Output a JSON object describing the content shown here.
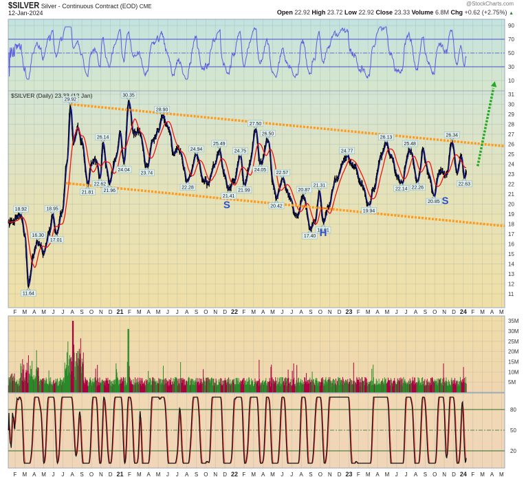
{
  "header": {
    "symbol": "$SILVER",
    "description": "Silver - Continuous Contract (EOD)",
    "exchange": "CME",
    "date": "12-Jan-2024",
    "brand": "@StockCharts.com",
    "open_label": "Open",
    "open": "22.92",
    "high_label": "High",
    "high": "23.72",
    "low_label": "Low",
    "low": "22.92",
    "close_label": "Close",
    "close": "23.33",
    "volume_label": "Volume",
    "volume": "6.8M",
    "chg_label": "Chg",
    "chg": "+0.62 (+2.75%)",
    "chg_icon": "triangle-up-icon"
  },
  "chart_data": {
    "type": "line",
    "title": "$SILVER Silver - Continuous Contract (EOD) CME",
    "price_label": "$SILVER (Daily) 23.33 (12 Jan)",
    "x_unit": "months since Feb 2020",
    "x_labels": [
      "F",
      "M",
      "A",
      "M",
      "J",
      "J",
      "A",
      "S",
      "O",
      "N",
      "D",
      "21",
      "F",
      "M",
      "A",
      "M",
      "J",
      "J",
      "A",
      "S",
      "O",
      "N",
      "D",
      "22",
      "F",
      "M",
      "A",
      "M",
      "J",
      "J",
      "A",
      "S",
      "O",
      "N",
      "D",
      "23",
      "F",
      "M",
      "A",
      "M",
      "J",
      "J",
      "A",
      "S",
      "O",
      "N",
      "D",
      "24",
      "F",
      "M",
      "A",
      "M"
    ],
    "year_labels": [
      "21",
      "22",
      "23",
      "24"
    ],
    "price_ticks": [
      11,
      12,
      13,
      14,
      15,
      16,
      17,
      18,
      19,
      20,
      21,
      22,
      23,
      24,
      25,
      26,
      27,
      28,
      29,
      30,
      31
    ],
    "rsi_ticks": [
      90,
      70,
      50,
      30,
      10
    ],
    "volume_ticks": [
      "35M",
      "30M",
      "25M",
      "20M",
      "15M",
      "10M",
      "5M"
    ],
    "stoch_ticks": [
      80,
      50,
      20
    ],
    "price_keypoints": [
      [
        -0.7,
        18.0
      ],
      [
        0.6,
        18.92
      ],
      [
        1.0,
        17
      ],
      [
        1.4,
        11.64
      ],
      [
        1.9,
        15
      ],
      [
        2.4,
        16.3
      ],
      [
        3.0,
        15.2
      ],
      [
        3.6,
        17
      ],
      [
        3.9,
        18.95
      ],
      [
        4.3,
        17.01
      ],
      [
        4.9,
        19
      ],
      [
        5.4,
        24
      ],
      [
        5.8,
        29.92
      ],
      [
        6.1,
        26
      ],
      [
        6.6,
        27.5
      ],
      [
        7.0,
        26
      ],
      [
        7.6,
        21.81
      ],
      [
        8.0,
        24
      ],
      [
        8.4,
        24.5
      ],
      [
        8.9,
        22.62
      ],
      [
        9.2,
        26.14
      ],
      [
        9.6,
        23.5
      ],
      [
        9.9,
        21.96
      ],
      [
        10.5,
        24.5
      ],
      [
        11.0,
        27
      ],
      [
        11.4,
        24.04
      ],
      [
        11.9,
        30.35
      ],
      [
        12.4,
        27
      ],
      [
        13.0,
        27.5
      ],
      [
        13.8,
        23.74
      ],
      [
        14.5,
        26.5
      ],
      [
        15.0,
        27.5
      ],
      [
        15.4,
        28.9
      ],
      [
        16.1,
        27.5
      ],
      [
        16.6,
        25
      ],
      [
        17.2,
        25.5
      ],
      [
        18.1,
        22.28
      ],
      [
        19.0,
        24.94
      ],
      [
        19.7,
        22.5
      ],
      [
        20.2,
        22
      ],
      [
        20.9,
        24
      ],
      [
        21.4,
        25.49
      ],
      [
        21.9,
        23
      ],
      [
        22.4,
        21.41
      ],
      [
        23.0,
        22.5
      ],
      [
        23.6,
        24.75
      ],
      [
        24.0,
        21.99
      ],
      [
        24.6,
        24
      ],
      [
        25.2,
        27.5
      ],
      [
        25.7,
        24.05
      ],
      [
        26.5,
        26.5
      ],
      [
        27.0,
        22.5
      ],
      [
        27.4,
        20.42
      ],
      [
        28.0,
        22.57
      ],
      [
        28.7,
        21
      ],
      [
        29.4,
        18.5
      ],
      [
        30.3,
        20.87
      ],
      [
        30.9,
        17.4
      ],
      [
        31.5,
        18.5
      ],
      [
        31.9,
        21.31
      ],
      [
        32.3,
        18.01
      ],
      [
        32.9,
        20
      ],
      [
        33.6,
        22.5
      ],
      [
        34.3,
        24
      ],
      [
        34.8,
        24.77
      ],
      [
        35.5,
        24
      ],
      [
        36.3,
        22
      ],
      [
        37.1,
        19.94
      ],
      [
        37.7,
        22
      ],
      [
        38.3,
        24.5
      ],
      [
        38.9,
        26.13
      ],
      [
        39.4,
        25
      ],
      [
        40.0,
        23
      ],
      [
        40.5,
        22.14
      ],
      [
        41.4,
        25.48
      ],
      [
        42.2,
        22.26
      ],
      [
        42.8,
        25.3
      ],
      [
        43.3,
        23
      ],
      [
        43.9,
        20.85
      ],
      [
        44.5,
        23.3
      ],
      [
        45.2,
        22.8
      ],
      [
        45.8,
        26.34
      ],
      [
        46.3,
        23
      ],
      [
        46.8,
        24.7
      ],
      [
        47.1,
        22.63
      ],
      [
        47.3,
        23.33
      ]
    ],
    "annotations": [
      {
        "label": "18.92",
        "m": 0.6,
        "v": 18.92,
        "pos": "above"
      },
      {
        "label": "11.64",
        "m": 1.4,
        "v": 11.64,
        "pos": "below"
      },
      {
        "label": "16.30",
        "m": 2.4,
        "v": 16.3,
        "pos": "above"
      },
      {
        "label": "18.95",
        "m": 3.9,
        "v": 18.95,
        "pos": "above"
      },
      {
        "label": "17.01",
        "m": 4.3,
        "v": 17.01,
        "pos": "below"
      },
      {
        "label": "29.92",
        "m": 5.8,
        "v": 29.92,
        "pos": "above"
      },
      {
        "label": "21.81",
        "m": 7.6,
        "v": 21.81,
        "pos": "below"
      },
      {
        "label": "26.14",
        "m": 9.2,
        "v": 26.14,
        "pos": "above"
      },
      {
        "label": "22.62",
        "m": 8.9,
        "v": 22.62,
        "pos": "below"
      },
      {
        "label": "21.96",
        "m": 9.9,
        "v": 21.96,
        "pos": "below"
      },
      {
        "label": "24.04",
        "m": 11.4,
        "v": 24.04,
        "pos": "below"
      },
      {
        "label": "30.35",
        "m": 11.9,
        "v": 30.35,
        "pos": "above"
      },
      {
        "label": "23.74",
        "m": 13.8,
        "v": 23.74,
        "pos": "below"
      },
      {
        "label": "28.90",
        "m": 15.4,
        "v": 28.9,
        "pos": "above"
      },
      {
        "label": "22.28",
        "m": 18.1,
        "v": 22.28,
        "pos": "below"
      },
      {
        "label": "24.94",
        "m": 19.0,
        "v": 24.94,
        "pos": "above"
      },
      {
        "label": "25.49",
        "m": 21.4,
        "v": 25.49,
        "pos": "above"
      },
      {
        "label": "21.41",
        "m": 22.4,
        "v": 21.41,
        "pos": "below"
      },
      {
        "label": "24.75",
        "m": 23.6,
        "v": 24.75,
        "pos": "above"
      },
      {
        "label": "21.99",
        "m": 24.0,
        "v": 21.99,
        "pos": "below"
      },
      {
        "label": "27.50",
        "m": 25.2,
        "v": 27.5,
        "pos": "above"
      },
      {
        "label": "24.05",
        "m": 25.7,
        "v": 24.05,
        "pos": "below"
      },
      {
        "label": "26.50",
        "m": 26.5,
        "v": 26.5,
        "pos": "above"
      },
      {
        "label": "20.42",
        "m": 27.4,
        "v": 20.42,
        "pos": "below"
      },
      {
        "label": "22.57",
        "m": 28.0,
        "v": 22.57,
        "pos": "above"
      },
      {
        "label": "20.87",
        "m": 30.3,
        "v": 20.87,
        "pos": "above"
      },
      {
        "label": "17.40",
        "m": 30.9,
        "v": 17.4,
        "pos": "below"
      },
      {
        "label": "21.31",
        "m": 31.9,
        "v": 21.31,
        "pos": "above"
      },
      {
        "label": "18.01",
        "m": 32.3,
        "v": 18.01,
        "pos": "below"
      },
      {
        "label": "24.77",
        "m": 34.8,
        "v": 24.77,
        "pos": "above"
      },
      {
        "label": "19.94",
        "m": 37.1,
        "v": 19.94,
        "pos": "below"
      },
      {
        "label": "26.13",
        "m": 38.9,
        "v": 26.13,
        "pos": "above"
      },
      {
        "label": "22.14",
        "m": 40.5,
        "v": 22.14,
        "pos": "below"
      },
      {
        "label": "25.48",
        "m": 41.4,
        "v": 25.48,
        "pos": "above"
      },
      {
        "label": "22.26",
        "m": 42.2,
        "v": 22.26,
        "pos": "below"
      },
      {
        "label": "20.85",
        "m": 43.9,
        "v": 20.85,
        "pos": "below"
      },
      {
        "label": "26.34",
        "m": 45.8,
        "v": 26.34,
        "pos": "above"
      },
      {
        "label": "22.63",
        "m": 47.1,
        "v": 22.63,
        "pos": "below"
      }
    ],
    "trendlines": [
      {
        "name": "upper-channel",
        "color": "#ff9a1a",
        "from": [
          5.8,
          30.0
        ],
        "to": [
          51.3,
          25.8
        ]
      },
      {
        "name": "lower-channel",
        "color": "#ff9a1a",
        "from": [
          5.3,
          22.1
        ],
        "to": [
          51.3,
          17.8
        ]
      }
    ],
    "projection_arrow": {
      "color": "#22aa22",
      "from": [
        48.5,
        23.8
      ],
      "to": [
        50.3,
        32.3
      ]
    },
    "pattern_labels": [
      {
        "text": "S",
        "m": 22.2,
        "v": 19.6
      },
      {
        "text": "H",
        "m": 32.3,
        "v": 16.8
      },
      {
        "text": "S",
        "m": 45.1,
        "v": 20.0
      }
    ],
    "colors": {
      "price": "#000000",
      "short_ma": "#1a1aa0",
      "long_ma": "#ee1111",
      "rsi": "#5a5ae0",
      "volume_up": "#2a8a2a",
      "volume_down": "#aa0040",
      "stoch_k": "#111111",
      "stoch_d": "#ff3333"
    }
  }
}
